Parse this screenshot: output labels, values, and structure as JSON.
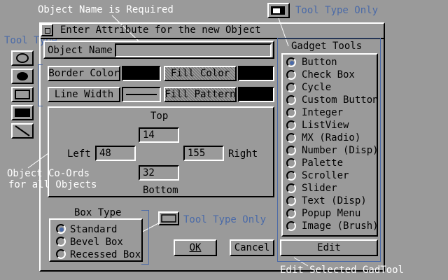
{
  "window": {
    "title": "Enter Attribute for the new Object"
  },
  "annotations": {
    "object_name_required": "Object Name is Required",
    "tool_type": "Tool Type",
    "tool_type_only_top": "Tool Type Only",
    "tool_type_only_mid": "Tool Type Only",
    "coords_line1": "Object Co-Ords",
    "coords_line2": "for all Objects",
    "edit_selected": "Edit Selected GadTool"
  },
  "form": {
    "object_name_label": "Object Name",
    "object_name_value": "",
    "border_color_label": "Border Color",
    "fill_color_label": "Fill Color",
    "line_width_label": "Line Width",
    "fill_pattern_label": "Fill Pattern",
    "top_label": "Top",
    "left_label": "Left",
    "right_label": "Right",
    "bottom_label": "Bottom",
    "top_value": "14",
    "left_value": "48",
    "right_value": "155",
    "bottom_value": "32"
  },
  "box_type": {
    "title": "Box Type",
    "options": [
      "Standard",
      "Bevel Box",
      "Recessed Box"
    ],
    "selected": "Standard"
  },
  "buttons": {
    "ok": "OK",
    "cancel": "Cancel",
    "edit": "Edit"
  },
  "gadget_tools": {
    "title": "Gadget Tools",
    "items": [
      "Button",
      "Check Box",
      "Cycle",
      "Custom Button",
      "Integer",
      "ListView",
      "MX (Radio)",
      "Number (Disp)",
      "Palette",
      "Scroller",
      "Slider",
      "Text (Disp)",
      "Popup Menu",
      "Image (Brush)"
    ],
    "selected": "Button"
  },
  "tool_icons": [
    "circle-outline-icon",
    "circle-filled-icon",
    "rectangle-outline-icon",
    "rectangle-filled-icon",
    "line-icon"
  ],
  "colors": {
    "background": "#9a9a9a",
    "accent": "#4a6aa8",
    "annotation": "#ffffff"
  }
}
